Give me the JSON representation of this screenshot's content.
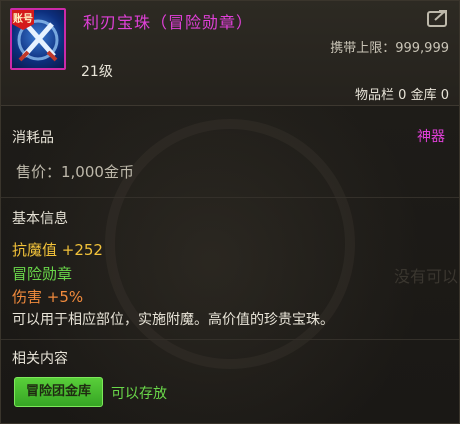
{
  "item": {
    "name": "利刃宝珠（冒险勋章）",
    "badge": "账号",
    "level": "21级",
    "carry_limit_label": "携带上限",
    "carry_limit_value": "999,999",
    "storage": "物品栏 0 金库 0"
  },
  "type_section": {
    "title": "消耗品",
    "rarity": "神器",
    "price": "售价：1,000金币"
  },
  "basic_info": {
    "title": "基本信息",
    "stat1_label": "抗魔值 +252",
    "stat2_label": "冒险勋章",
    "stat3_name": "伤害 +",
    "stat3_value": "5%",
    "description": "可以用于相应部位，实施附魔。高价值的珍贵宝珠。"
  },
  "related": {
    "title": "相关内容",
    "tag_button": "冒险团金库",
    "storable_text": "可以存放"
  },
  "watermark": "没有可以"
}
